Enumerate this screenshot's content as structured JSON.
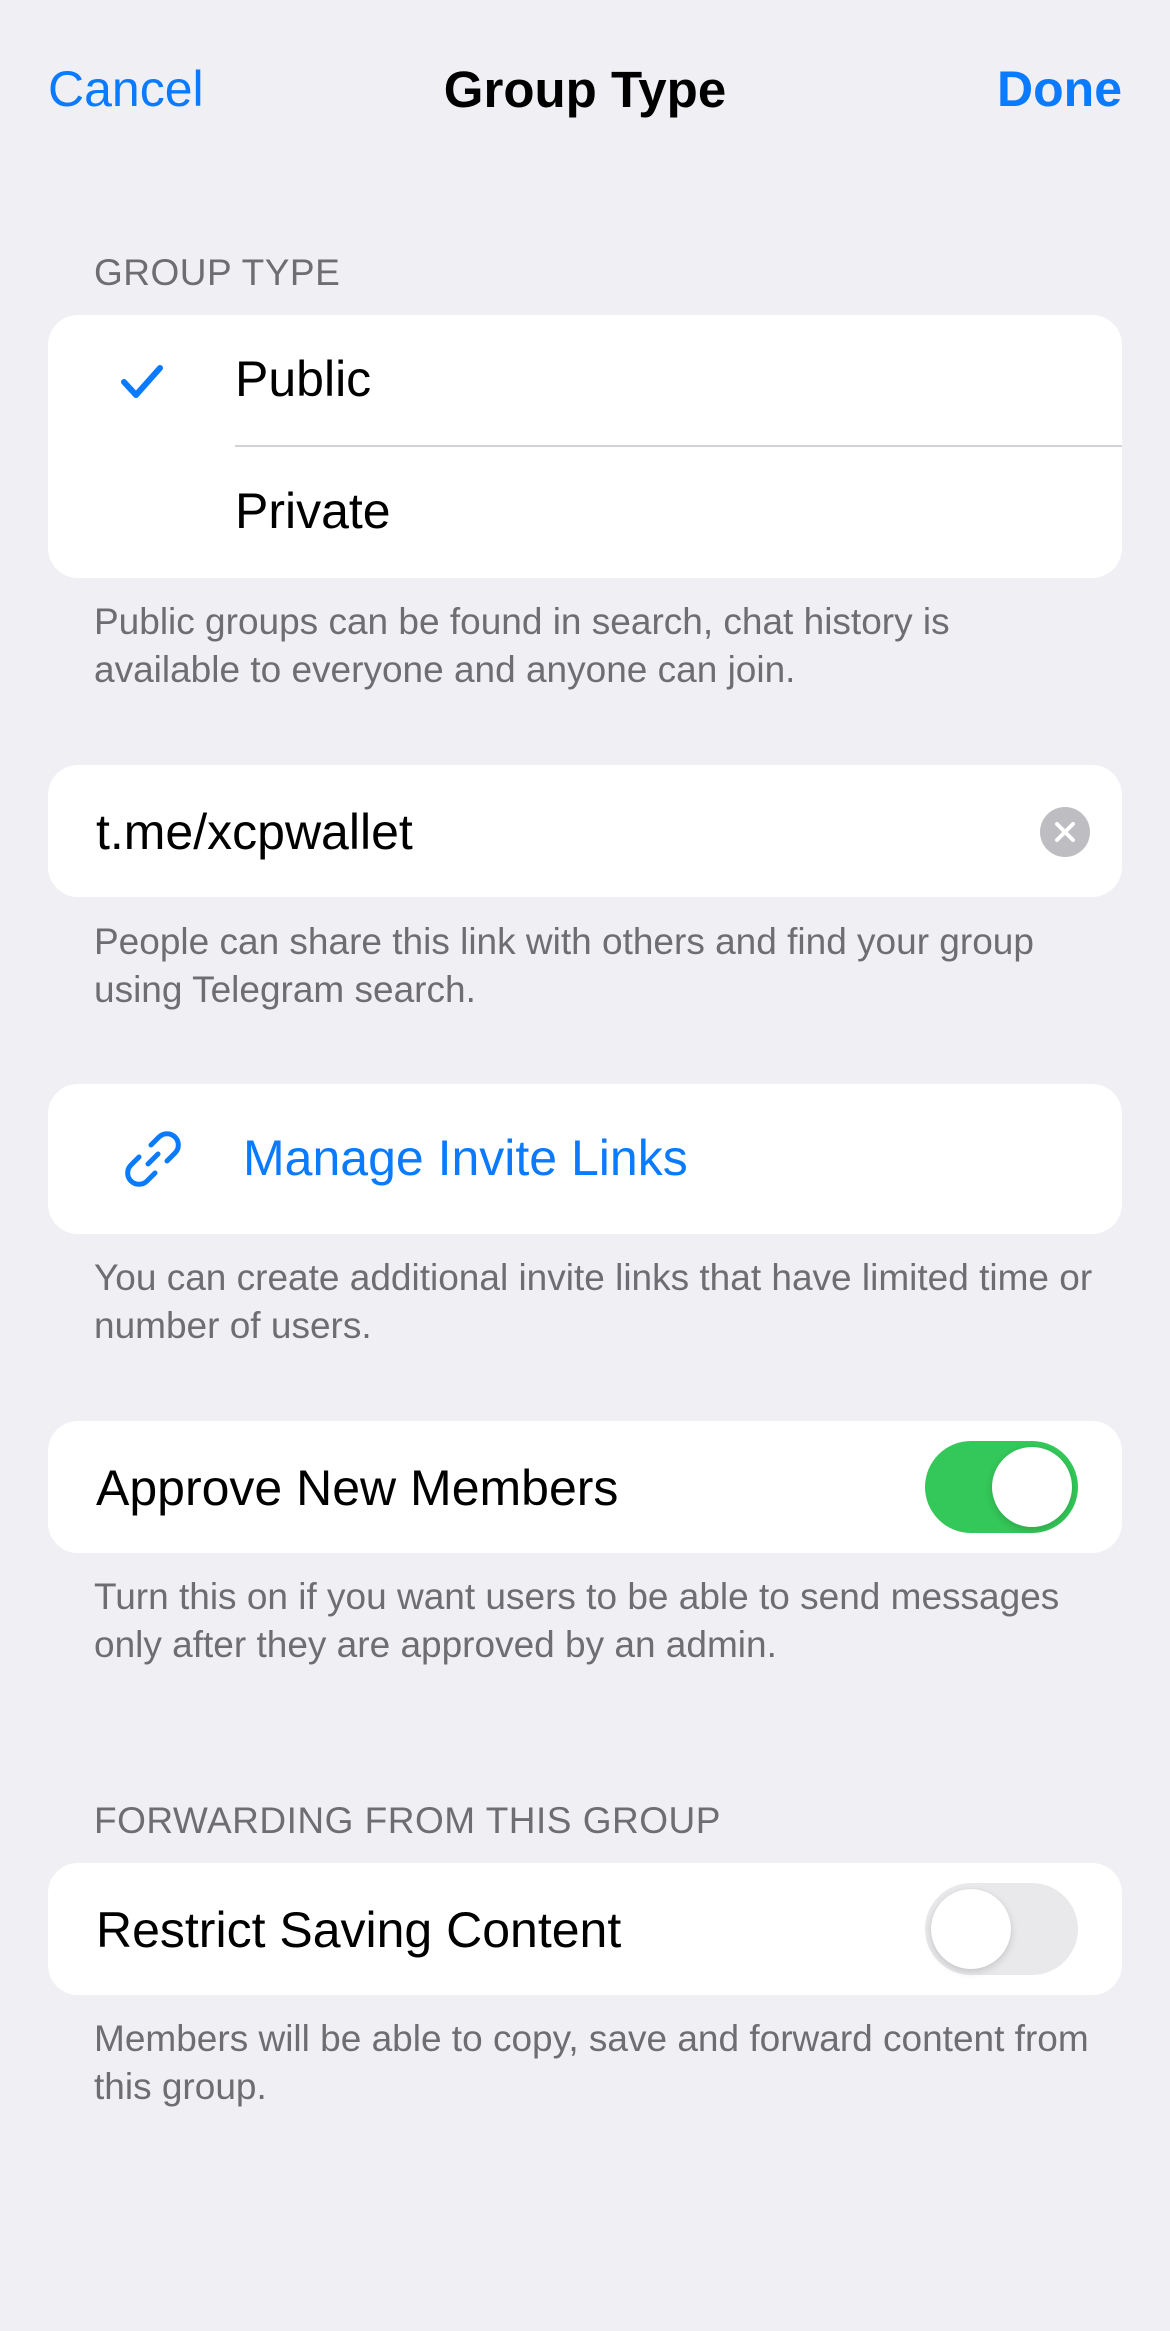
{
  "nav": {
    "cancel_label": "Cancel",
    "title": "Group Type",
    "done_label": "Done"
  },
  "group_type": {
    "header": "GROUP TYPE",
    "options": [
      {
        "label": "Public",
        "selected": true
      },
      {
        "label": "Private",
        "selected": false
      }
    ],
    "footer": "Public groups can be found in search, chat history is available to everyone and anyone can join."
  },
  "link": {
    "value": "t.me/xcpwallet",
    "footer": "People can share this link with others and find your group using Telegram search."
  },
  "invite_links": {
    "label": "Manage Invite Links",
    "footer": "You can create additional invite links that have limited time or number of users."
  },
  "approve": {
    "label": "Approve New Members",
    "enabled": true,
    "footer": "Turn this on if you want users to be able to send messages only after they are approved by an admin."
  },
  "forwarding": {
    "header": "FORWARDING FROM THIS GROUP",
    "label": "Restrict Saving Content",
    "enabled": false,
    "footer": "Members will be able to copy, save and forward content from this group."
  },
  "colors": {
    "accent": "#0a7aff",
    "toggle_on": "#34c759",
    "background": "#efeff4",
    "secondary_text": "#6d6d72"
  },
  "icons": {
    "checkmark": "checkmark-icon",
    "clear": "clear-icon",
    "link": "link-icon"
  }
}
